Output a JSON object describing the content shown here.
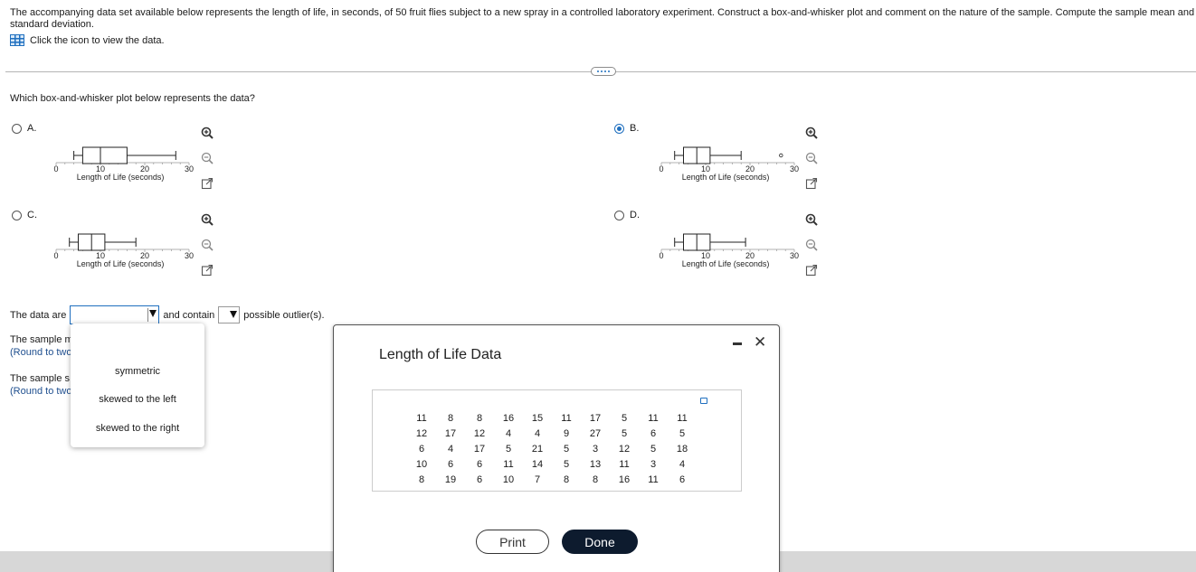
{
  "question": {
    "line1": "The accompanying data set available below represents the length of life, in seconds, of 50 fruit flies subject to a new spray in a controlled laboratory experiment. Construct a box-and-whisker plot and comment on the nature of the sample. Compute the sample mean and sam",
    "line2": "standard deviation.",
    "data_link": "Click the icon to view the data."
  },
  "sub_question": "Which box-and-whisker plot below represents the data?",
  "options": [
    {
      "letter": "A.",
      "selected": false,
      "min": 4,
      "q1": 6,
      "median": 10,
      "q3": 16,
      "max": 27,
      "outlier": null
    },
    {
      "letter": "B.",
      "selected": true,
      "min": 3,
      "q1": 5,
      "median": 8,
      "q3": 11,
      "max": 18,
      "outlier": 27
    },
    {
      "letter": "C.",
      "selected": false,
      "min": 3,
      "q1": 5,
      "median": 8,
      "q3": 11,
      "max": 18,
      "outlier": null
    },
    {
      "letter": "D.",
      "selected": false,
      "min": 3,
      "q1": 5,
      "median": 8,
      "q3": 11,
      "max": 19,
      "outlier": null
    }
  ],
  "plot_axis": {
    "label": "Length of Life (seconds)",
    "ticks": [
      "0",
      "10",
      "20",
      "30"
    ],
    "range": [
      0,
      30
    ]
  },
  "fill_in": {
    "prefix": "The data are",
    "middle": "and contain",
    "suffix": "possible outlier(s)."
  },
  "partial_rows": [
    {
      "main": "The sample m",
      "round": "(Round to two"
    },
    {
      "main": "The sample s",
      "round": "(Round to two"
    }
  ],
  "dropdown_menu": [
    "symmetric",
    "skewed to the left",
    "skewed to the right"
  ],
  "modal": {
    "title": "Length of Life Data",
    "rows": [
      [
        "11",
        "8",
        "8",
        "16",
        "15",
        "11",
        "17",
        "5",
        "11",
        "11"
      ],
      [
        "12",
        "17",
        "12",
        "4",
        "4",
        "9",
        "27",
        "5",
        "6",
        "5"
      ],
      [
        "6",
        "4",
        "17",
        "5",
        "21",
        "5",
        "3",
        "12",
        "5",
        "18"
      ],
      [
        "10",
        "6",
        "6",
        "11",
        "14",
        "5",
        "13",
        "11",
        "3",
        "4"
      ],
      [
        "8",
        "19",
        "6",
        "10",
        "7",
        "8",
        "8",
        "16",
        "11",
        "6"
      ]
    ],
    "print_label": "Print",
    "done_label": "Done"
  },
  "colors": {
    "accent": "#1f6fbf",
    "done_button": "#0d1b2e"
  }
}
